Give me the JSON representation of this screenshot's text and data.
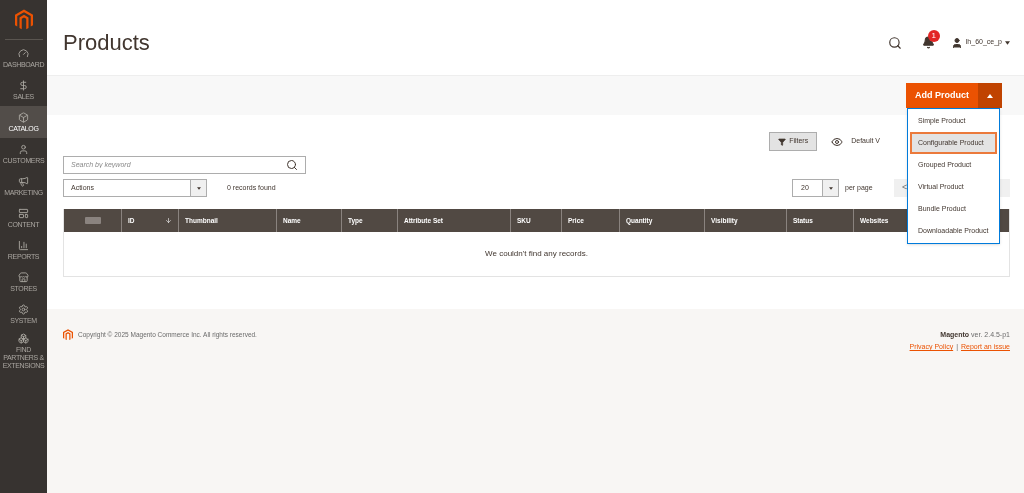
{
  "sidebar": {
    "items": [
      {
        "label": "DASHBOARD",
        "selected": false
      },
      {
        "label": "SALES",
        "selected": false
      },
      {
        "label": "CATALOG",
        "selected": true
      },
      {
        "label": "CUSTOMERS",
        "selected": false
      },
      {
        "label": "MARKETING",
        "selected": false
      },
      {
        "label": "CONTENT",
        "selected": false
      },
      {
        "label": "REPORTS",
        "selected": false
      },
      {
        "label": "STORES",
        "selected": false
      },
      {
        "label": "SYSTEM",
        "selected": false
      },
      {
        "label": "FIND PARTNERS & EXTENSIONS",
        "selected": false
      }
    ]
  },
  "header": {
    "title": "Products",
    "notifications": "1",
    "user": "lh_60_ce_p"
  },
  "add_product": {
    "label": "Add Product",
    "expanded": true,
    "menu": [
      {
        "label": "Simple Product",
        "selected": false
      },
      {
        "label": "Configurable Product",
        "selected": true
      },
      {
        "label": "Grouped Product",
        "selected": false
      },
      {
        "label": "Virtual Product",
        "selected": false
      },
      {
        "label": "Bundle Product",
        "selected": false
      },
      {
        "label": "Downloadable Product",
        "selected": false
      }
    ]
  },
  "toolbar": {
    "filters": "Filters",
    "view": "Default V",
    "search": {
      "placeholder": "Search by keyword"
    },
    "actions": "Actions",
    "records": "0 records found",
    "per_page_value": "20",
    "per_page": "per page",
    "pager_prev": "<"
  },
  "table": {
    "select_all": {
      "checked": false
    },
    "columns": [
      "ID",
      "Thumbnail",
      "Name",
      "Type",
      "Attribute Set",
      "SKU",
      "Price",
      "Quantity",
      "Visibility",
      "Status",
      "Websites"
    ],
    "empty": "We couldn't find any records."
  },
  "footer": {
    "copyright": "Copyright © 2025 Magento Commerce Inc. All rights reserved.",
    "brand": "Magento",
    "version": "ver. 2.4.5-p1",
    "links": [
      "Privacy Policy",
      "Report an issue"
    ],
    "separator": "|"
  }
}
